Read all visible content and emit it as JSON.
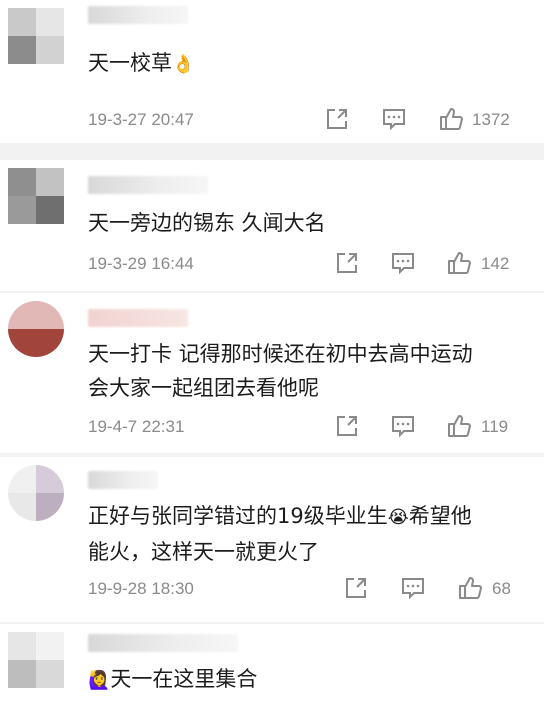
{
  "colors": {
    "text": "#1c1c1c",
    "meta": "#8a8a8a",
    "divider": "#f2f2f2",
    "background": "#ffffff"
  },
  "comments": [
    {
      "text": "天一校草",
      "emoji": "👌",
      "emoji_name": "ok-hand-emoji",
      "time": "19-3-27 20:47",
      "likes": "1372"
    },
    {
      "text": "天一旁边的锡东 久闻大名",
      "time": "19-3-29 16:44",
      "likes": "142"
    },
    {
      "text_line1": "天一打卡 记得那时候还在初中去高中运动",
      "text_line2": "会大家一起组团去看他呢",
      "time": "19-4-7 22:31",
      "likes": "119"
    },
    {
      "text_line1_a": "正好与张同学错过的19级毕业生",
      "emoji": "😭",
      "emoji_name": "crying-emoji",
      "text_line1_b": "希望他",
      "text_line2": "能火，这样天一就更火了",
      "time": "19-9-28 18:30",
      "likes": "68"
    },
    {
      "emoji": "🙋‍♀️",
      "emoji_name": "raising-hand-emoji",
      "text": "天一在这里集合"
    }
  ],
  "icons": {
    "share": "share-icon",
    "comment": "comment-icon",
    "like": "thumbs-up-icon"
  }
}
